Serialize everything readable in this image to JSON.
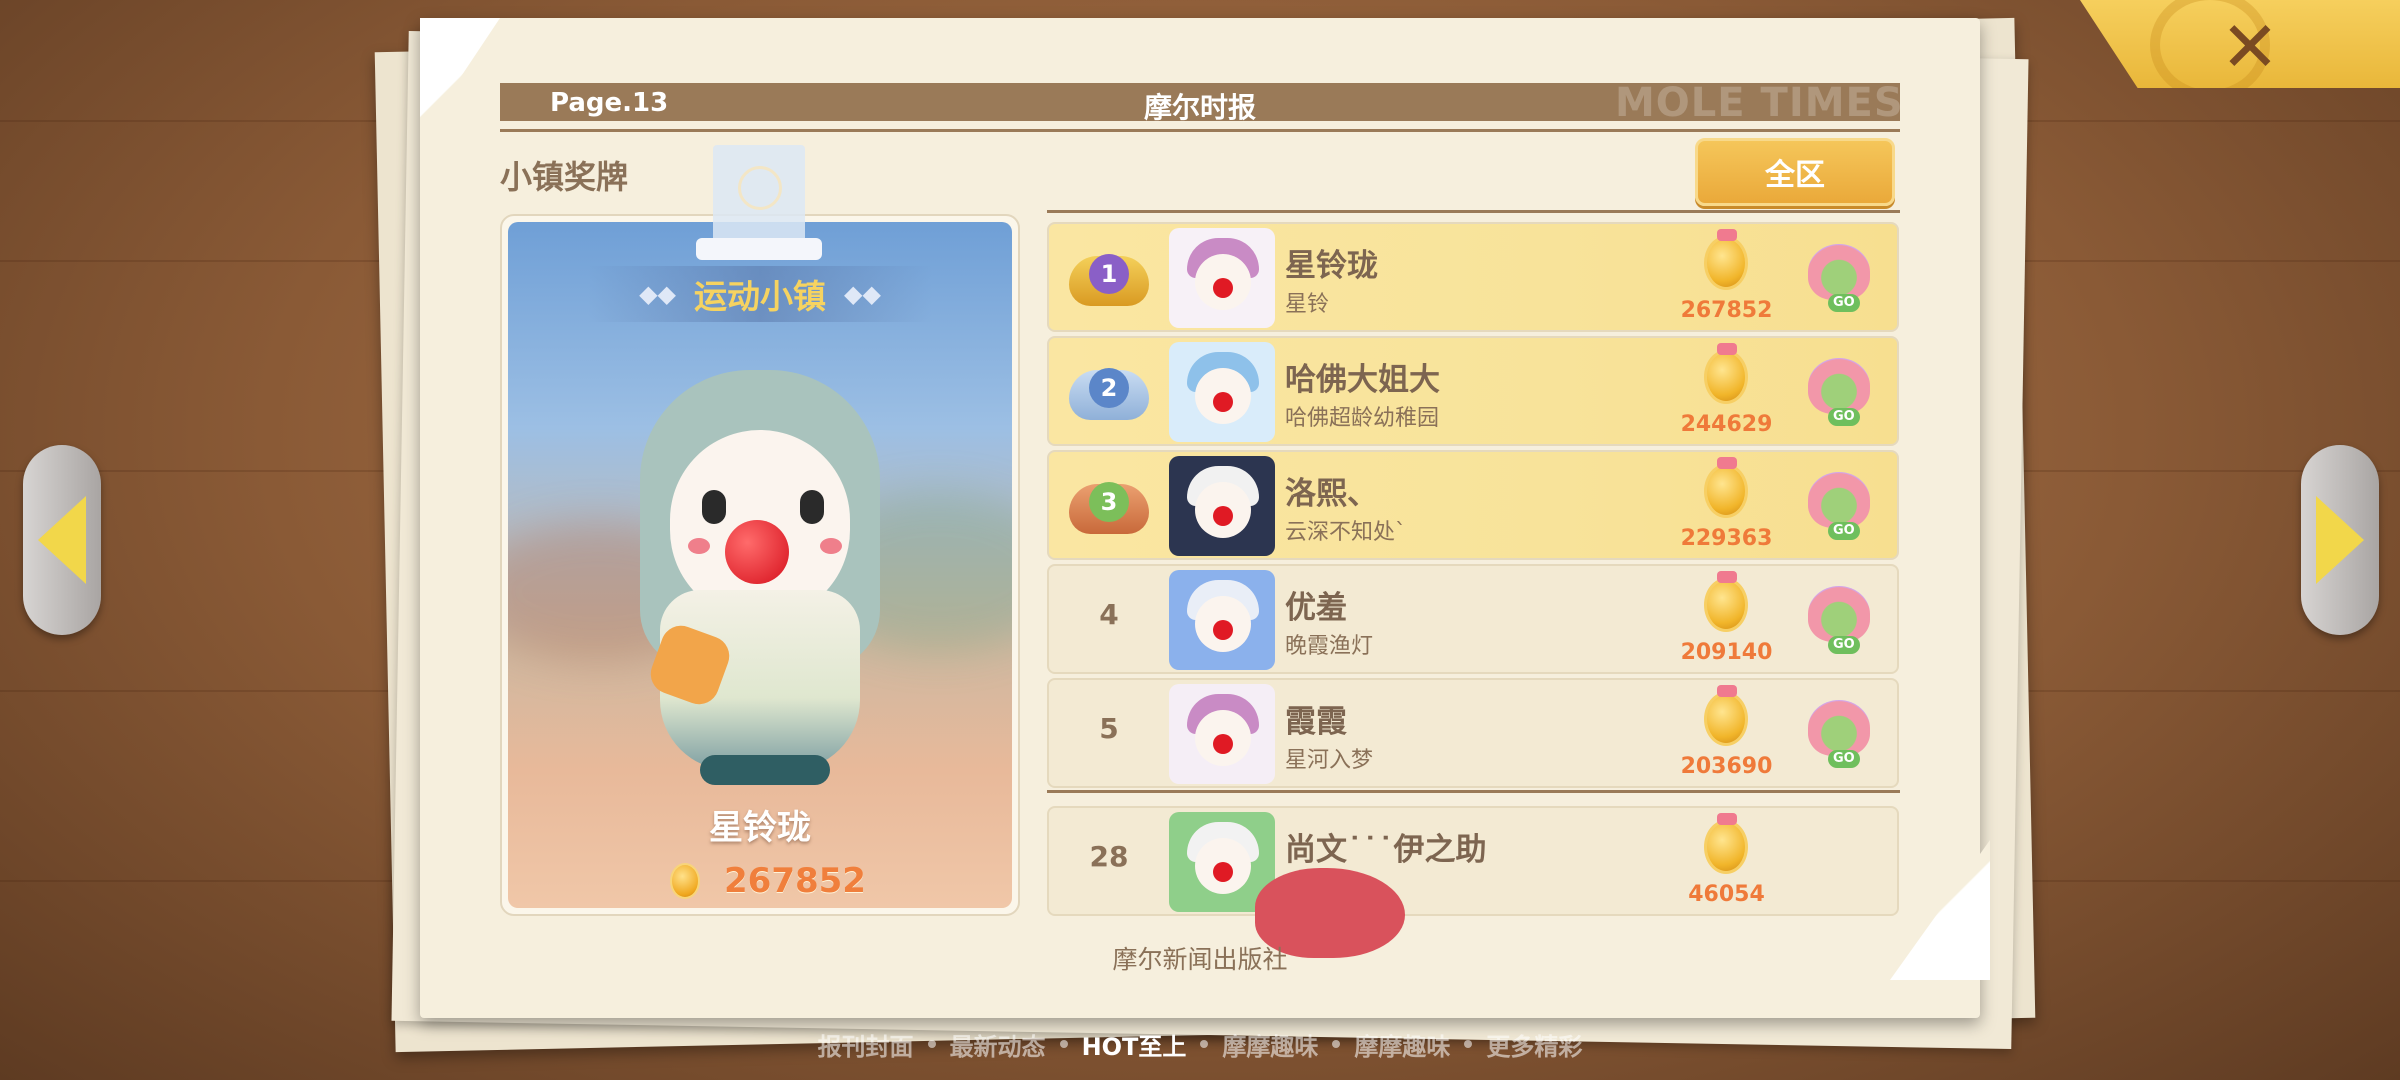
{
  "header": {
    "page_num": "Page.13",
    "title": "摩尔时报",
    "watermark": "MOLE TIMES"
  },
  "section": {
    "title": "小镇奖牌",
    "region_button": "全区"
  },
  "featured": {
    "town_label": "运动小镇",
    "name": "星铃珑",
    "score": "267852"
  },
  "ranking": [
    {
      "rank": "1",
      "name": "星铃珑",
      "sub": "星铃",
      "score": "267852",
      "go": "GO"
    },
    {
      "rank": "2",
      "name": "哈佛大姐大",
      "sub": "哈佛超龄幼稚园",
      "score": "244629",
      "go": "GO"
    },
    {
      "rank": "3",
      "name": "洛熙、",
      "sub": "云深不知处`",
      "score": "229363",
      "go": "GO"
    },
    {
      "rank": "4",
      "name": "优羞",
      "sub": "晚霞渔灯",
      "score": "209140",
      "go": "GO"
    },
    {
      "rank": "5",
      "name": "霞霞",
      "sub": "星河入梦",
      "score": "203690",
      "go": "GO"
    }
  ],
  "my_rank": {
    "rank": "28",
    "name": "尚文˙˙˙伊之助",
    "score": "46054"
  },
  "footer": {
    "publisher": "摩尔新闻出版社"
  },
  "bottom_nav": [
    "报刊封面",
    "最新动态",
    "HOT至上",
    "摩摩趣味",
    "摩摩趣味",
    "更多精彩"
  ],
  "bottom_nav_active_index": 2,
  "colors": {
    "header_bar": "#9a7a58",
    "gold_row": "#f8e39a",
    "score_text": "#ef7a3a",
    "region_button": "#eaa93a"
  },
  "icons": {
    "close": "close-icon",
    "prev": "arrow-left-icon",
    "next": "arrow-right-icon",
    "coin": "medal-coin-icon",
    "go": "go-visit-icon"
  }
}
